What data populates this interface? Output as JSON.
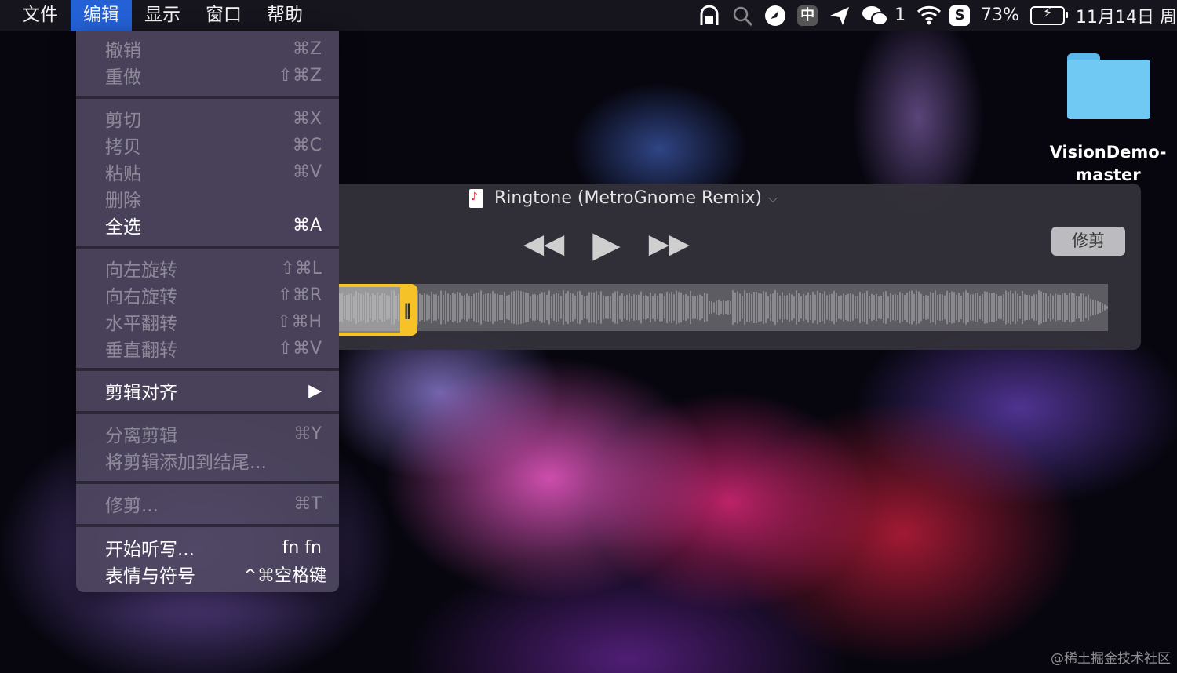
{
  "menubar": {
    "items": [
      "文件",
      "编辑",
      "显示",
      "窗口",
      "帮助"
    ],
    "active_index": 1,
    "status": {
      "input_method": "中",
      "wechat_count": "1",
      "battery_percent": "73%",
      "date": "11月14日 周"
    },
    "icons": [
      "shield-lock-icon",
      "search-person-icon",
      "bird-icon",
      "input-method-icon",
      "send-icon",
      "wechat-icon",
      "wifi-icon",
      "s-app-icon",
      "battery-charging-icon"
    ]
  },
  "edit_menu": {
    "groups": [
      [
        {
          "label": "撤销",
          "shortcut": "⌘Z",
          "enabled": false
        },
        {
          "label": "重做",
          "shortcut": "⇧⌘Z",
          "enabled": false
        }
      ],
      [
        {
          "label": "剪切",
          "shortcut": "⌘X",
          "enabled": false
        },
        {
          "label": "拷贝",
          "shortcut": "⌘C",
          "enabled": false
        },
        {
          "label": "粘贴",
          "shortcut": "⌘V",
          "enabled": false
        },
        {
          "label": "删除",
          "shortcut": "",
          "enabled": false
        },
        {
          "label": "全选",
          "shortcut": "⌘A",
          "enabled": true
        }
      ],
      [
        {
          "label": "向左旋转",
          "shortcut": "⇧⌘L",
          "enabled": false
        },
        {
          "label": "向右旋转",
          "shortcut": "⇧⌘R",
          "enabled": false
        },
        {
          "label": "水平翻转",
          "shortcut": "⇧⌘H",
          "enabled": false
        },
        {
          "label": "垂直翻转",
          "shortcut": "⇧⌘V",
          "enabled": false
        }
      ],
      [
        {
          "label": "剪辑对齐",
          "shortcut": "▶",
          "enabled": true
        }
      ],
      [
        {
          "label": "分离剪辑",
          "shortcut": "⌘Y",
          "enabled": false
        },
        {
          "label": "将剪辑添加到结尾...",
          "shortcut": "",
          "enabled": false
        }
      ],
      [
        {
          "label": "修剪...",
          "shortcut": "⌘T",
          "enabled": false
        }
      ],
      [
        {
          "label": "开始听写...",
          "shortcut": "fn fn",
          "enabled": true
        },
        {
          "label": "表情与符号",
          "shortcut": "^⌘空格键",
          "enabled": true
        }
      ]
    ]
  },
  "player": {
    "title": "Ringtone (MetroGnome Remix)",
    "trim_button": "修剪",
    "rewind_glyph": "◀◀",
    "play_glyph": "▶",
    "forward_glyph": "▶▶",
    "chevron_glyph": "⌵",
    "grip_glyph": "‖"
  },
  "desktop": {
    "folder_name_line1": "VisionDemo-",
    "folder_name_line2": "master"
  },
  "watermark": "@稀土掘金技术社区",
  "colors": {
    "menubar_active": "#2461d6",
    "trim_handle": "#f5c227",
    "folder": "#6fc9f3"
  }
}
